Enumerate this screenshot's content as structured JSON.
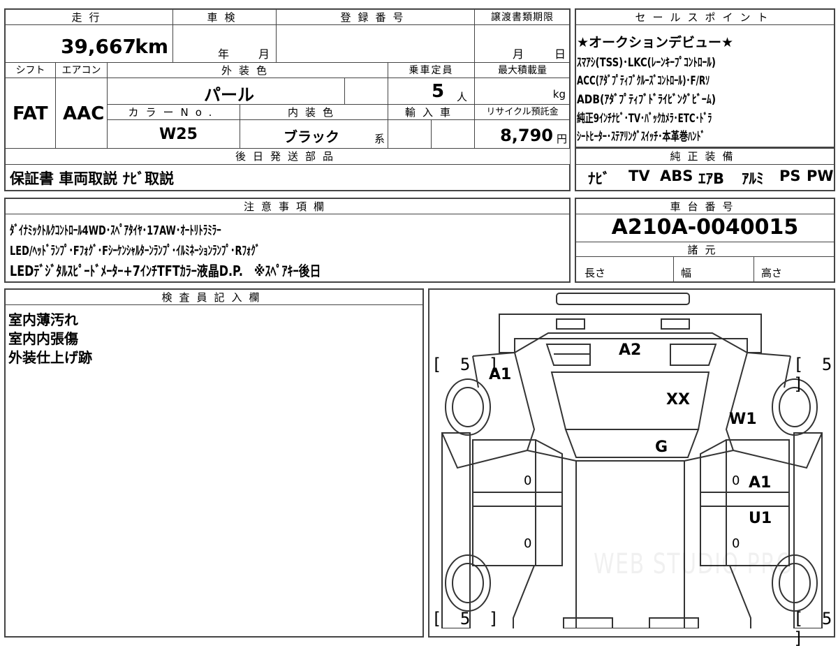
{
  "vehicle": {
    "mileage_label": "走行",
    "mileage_value": "39,667",
    "mileage_unit": "km",
    "shaken_label": "車検",
    "shaken_year": "年",
    "shaken_month": "月",
    "registration_label": "登録番号",
    "deadline_label": "譲渡書類期限",
    "deadline_month": "月",
    "deadline_day": "日",
    "shift_label": "シフト",
    "shift_value": "FAT",
    "aircon_label": "エアコン",
    "aircon_value": "AAC",
    "exterior_label": "外装色",
    "exterior_value": "パール",
    "capacity_label": "乗車定員",
    "capacity_value": "5",
    "capacity_unit": "人",
    "maxload_label": "最大積載量",
    "maxload_unit": "kg",
    "color_no_label": "カラーNo.",
    "color_no_value": "W25",
    "interior_label": "内装色",
    "interior_value": "ブラック",
    "interior_suffix": "系",
    "import_label": "輸入車",
    "recycle_label": "リサイクル預託金",
    "recycle_value": "8,790",
    "recycle_unit": "円"
  },
  "sales": {
    "header": "セールスポイント",
    "lines": [
      "★オークションデビュー★",
      "ｽﾏｱｼ(TSS)･LKC(ﾚｰﾝｷｰﾌﾟｺﾝﾄﾛｰﾙ)",
      "ACC(ｱﾀﾞﾌﾟﾃｨﾌﾞｸﾙｰｽﾞｺﾝﾄﾛｰﾙ)･F/Rｿ",
      "ADB(ｱﾀﾞﾌﾟﾃｨﾌﾞﾄﾞﾗｲﾋﾞﾝｸﾞﾋﾞｰﾑ)",
      "純正9ｲﾝﾁﾅﾋﾞ･TV･ﾊﾞｯｸｶﾒﾗ･ETC･ﾄﾞﾗ",
      "ｼｰﾄﾋｰﾀｰ･ｽﾃｱﾘﾝｸﾞｽｲｯﾁ･本革巻ﾊﾝﾄﾞ"
    ]
  },
  "later_parts": {
    "header": "後日発送部品",
    "value": "保証書 車両取説 ﾅﾋﾞ取説"
  },
  "equipment": {
    "header": "純正装備",
    "items": [
      "ﾅﾋﾞ",
      "TV",
      "ABS",
      "ｴｱB",
      "ｱﾙﾐ",
      "PS",
      "PW"
    ]
  },
  "notes": {
    "header": "注意事項欄",
    "lines": [
      "ﾀﾞｲﾅﾐｯｸﾄﾙｸｺﾝﾄﾛｰﾙ4WD･ｽﾍﾟｱﾀｲﾔ･17AW･ｵｰﾄﾘﾄﾗﾐﾗｰ",
      "LED/ﾍｯﾄﾞﾗﾝﾌﾟ･Fﾌｫｸﾞ･Fｼｰｹﾝｼｬﾙﾀｰﾝﾗﾝﾌﾟ･ｲﾙﾐﾈｰｼｮﾝﾗﾝﾌﾟ･Rﾌｫｸﾞ",
      "LEDﾃﾞｼﾞﾀﾙｽﾋﾟｰﾄﾞﾒｰﾀｰ+7ｲﾝﾁTFTｶﾗｰ液晶D.P.　※ｽﾍﾟｱｷｰ後日"
    ]
  },
  "chassis": {
    "header": "車台番号",
    "value": "A210A-0040015",
    "spec_header": "諸元",
    "length_label": "長さ",
    "width_label": "幅",
    "height_label": "高さ"
  },
  "inspector": {
    "header": "検査員記入欄",
    "lines": [
      "室内薄汚れ",
      "室内内張傷",
      "外装仕上げ跡"
    ]
  },
  "diagram": {
    "tire_front_left": "[ 5 ]",
    "tire_front_right": "[ 5 ]",
    "tire_rear_left": "[ 5 ]",
    "tire_rear_right": "[ 5 ]",
    "marks": {
      "hood_a2": "A2",
      "fender_a1": "A1",
      "windshield_xx": "XX",
      "right_w1": "W1",
      "roof_g": "G",
      "door_a1": "A1",
      "door_u1": "U1",
      "zero_1": "0",
      "zero_2": "0",
      "zero_3": "0",
      "zero_4": "0"
    },
    "watermark": "WEB STUDIO PRO"
  }
}
